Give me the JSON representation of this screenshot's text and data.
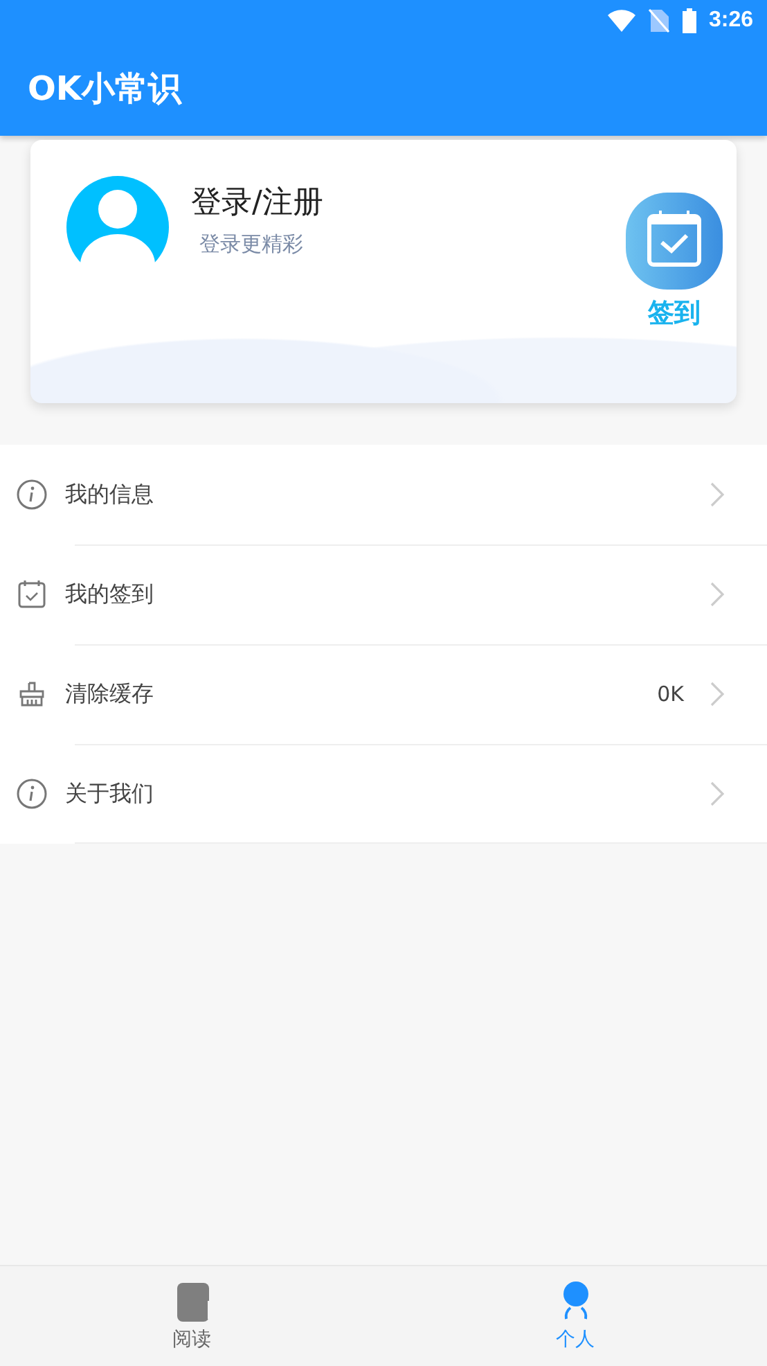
{
  "status_bar": {
    "time": "3:26"
  },
  "app_bar": {
    "title": "OK小常识"
  },
  "profile": {
    "name": "登录/注册",
    "subtitle": "登录更精彩",
    "checkin_label": "签到"
  },
  "menu": [
    {
      "kind": "info",
      "label": "我的信息"
    },
    {
      "kind": "calendar",
      "label": "我的签到"
    },
    {
      "kind": "broom",
      "label": "清除缓存",
      "value": "0K"
    },
    {
      "kind": "info",
      "label": "关于我们"
    }
  ],
  "tabs": [
    {
      "kind": "book",
      "label": "阅读",
      "selected": false
    },
    {
      "kind": "person",
      "label": "个人",
      "selected": true
    }
  ]
}
